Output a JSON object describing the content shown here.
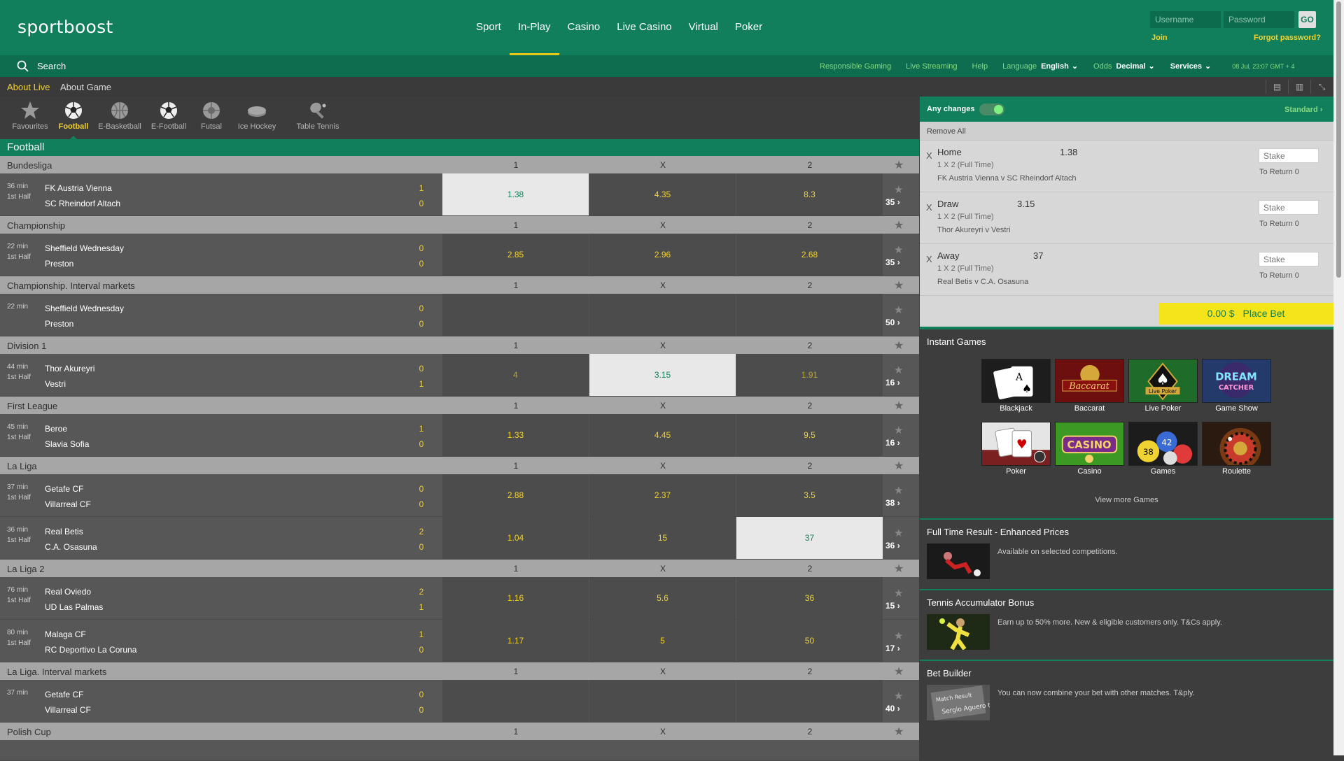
{
  "brand": {
    "logo": "sportboost"
  },
  "nav": [
    "Sport",
    "In-Play",
    "Casino",
    "Live Casino",
    "Virtual",
    "Poker"
  ],
  "login": {
    "username_placeholder": "Username",
    "password_placeholder": "Password",
    "go": "GO",
    "join": "Join",
    "forgot": "Forgot password?"
  },
  "subbar": {
    "search": "Search",
    "responsible": "Responsible Gaming",
    "streaming": "Live Streaming",
    "help": "Help",
    "language_label": "Language",
    "language_value": "English",
    "odds_label": "Odds",
    "odds_value": "Decimal",
    "services": "Services",
    "clock": "08 Jul, 23:07 GMT + 4"
  },
  "context": {
    "about_live": "About Live",
    "about_game": "About Game"
  },
  "sports": [
    {
      "label": "Favourites",
      "icon": "star-icon",
      "active": false
    },
    {
      "label": "Football",
      "icon": "football-icon",
      "active": true
    },
    {
      "label": "E-Basketball",
      "icon": "basketball-icon",
      "active": false
    },
    {
      "label": "E-Football",
      "icon": "football-icon",
      "active": false
    },
    {
      "label": "Futsal",
      "icon": "futsal-icon",
      "active": false
    },
    {
      "label": "Ice Hockey",
      "icon": "puck-icon",
      "active": false
    },
    {
      "label": "Table Tennis",
      "icon": "paddle-icon",
      "active": false
    }
  ],
  "section_title": "Football",
  "cols": {
    "one": "1",
    "x": "X",
    "two": "2"
  },
  "leagues": [
    {
      "name": "Bundesliga",
      "events": [
        {
          "time": "36 min",
          "period": "1st Half",
          "home": "FK Austria Vienna",
          "away": "SC Rheindorf Altach",
          "hs": "1",
          "as": "0",
          "o1": "1.38",
          "ox": "4.35",
          "o2": "8.3",
          "more": "35",
          "selected": "1"
        }
      ]
    },
    {
      "name": "Championship",
      "events": [
        {
          "time": "22 min",
          "period": "1st Half",
          "home": "Sheffield Wednesday",
          "away": "Preston",
          "hs": "0",
          "as": "0",
          "o1": "2.85",
          "ox": "2.96",
          "o2": "2.68",
          "more": "35",
          "selected": ""
        }
      ]
    },
    {
      "name": "Championship. Interval markets",
      "events": [
        {
          "time": "22 min",
          "period": "",
          "home": "Sheffield Wednesday",
          "away": "Preston",
          "hs": "0",
          "as": "0",
          "o1": "",
          "ox": "",
          "o2": "",
          "more": "50",
          "selected": "",
          "suspended": true
        }
      ]
    },
    {
      "name": "Division 1",
      "events": [
        {
          "time": "44 min",
          "period": "1st Half",
          "home": "Thor Akureyri",
          "away": "Vestri",
          "hs": "0",
          "as": "1",
          "o1": "4",
          "ox": "3.15",
          "o2": "1.91",
          "more": "16",
          "selected": "x",
          "dim": true
        }
      ]
    },
    {
      "name": "First League",
      "events": [
        {
          "time": "45 min",
          "period": "1st Half",
          "home": "Beroe",
          "away": "Slavia Sofia",
          "hs": "1",
          "as": "0",
          "o1": "1.33",
          "ox": "4.45",
          "o2": "9.5",
          "more": "16",
          "selected": ""
        }
      ]
    },
    {
      "name": "La Liga",
      "events": [
        {
          "time": "37 min",
          "period": "1st Half",
          "home": "Getafe CF",
          "away": "Villarreal CF",
          "hs": "0",
          "as": "0",
          "o1": "2.88",
          "ox": "2.37",
          "o2": "3.5",
          "more": "38",
          "selected": ""
        },
        {
          "time": "36 min",
          "period": "1st Half",
          "home": "Real Betis",
          "away": "C.A. Osasuna",
          "hs": "2",
          "as": "0",
          "o1": "1.04",
          "ox": "15",
          "o2": "37",
          "more": "36",
          "selected": "2"
        }
      ]
    },
    {
      "name": "La Liga 2",
      "events": [
        {
          "time": "76 min",
          "period": "1st Half",
          "home": "Real Oviedo",
          "away": "UD Las Palmas",
          "hs": "2",
          "as": "1",
          "o1": "1.16",
          "ox": "5.6",
          "o2": "36",
          "more": "15",
          "selected": ""
        },
        {
          "time": "80 min",
          "period": "1st Half",
          "home": "Malaga CF",
          "away": "RC Deportivo La Coruna",
          "hs": "1",
          "as": "0",
          "o1": "1.17",
          "ox": "5",
          "o2": "50",
          "more": "17",
          "selected": ""
        }
      ]
    },
    {
      "name": "La Liga. Interval markets",
      "events": [
        {
          "time": "37 min",
          "period": "",
          "home": "Getafe CF",
          "away": "Villarreal CF",
          "hs": "0",
          "as": "0",
          "o1": "",
          "ox": "",
          "o2": "",
          "more": "40",
          "selected": "",
          "suspended": true
        }
      ]
    },
    {
      "name": "Polish Cup",
      "events": []
    }
  ],
  "betslip": {
    "any_changes": "Any changes",
    "standard": "Standard",
    "remove_all": "Remove All",
    "items": [
      {
        "selection": "Home",
        "price": "1.38",
        "market": "1 X 2 (Full Time)",
        "event": "FK Austria Vienna v SC Rheindorf Altach",
        "stake_placeholder": "Stake",
        "to_return": "To Return 0"
      },
      {
        "selection": "Draw",
        "price": "3.15",
        "market": "1 X 2 (Full Time)",
        "event": "Thor Akureyri v Vestri",
        "stake_placeholder": "Stake",
        "to_return": "To Return 0"
      },
      {
        "selection": "Away",
        "price": "37",
        "market": "1 X 2 (Full Time)",
        "event": "Real Betis v C.A. Osasuna",
        "stake_placeholder": "Stake",
        "to_return": "To Return 0"
      }
    ],
    "total": "0.00 $",
    "place_bet": "Place Bet"
  },
  "instant_games": {
    "title": "Instant Games",
    "games": [
      "Blackjack",
      "Baccarat",
      "Live Poker",
      "Game Show",
      "Poker",
      "Casino",
      "Games",
      "Roulette"
    ],
    "view_more": "View more Games"
  },
  "promos": [
    {
      "title": "Full Time Result - Enhanced Prices",
      "text": "Available on selected competitions."
    },
    {
      "title": "Tennis Accumulator Bonus",
      "text": "Earn up to 50% more. New & eligible customers only. T&Cs apply."
    },
    {
      "title": "Bet Builder",
      "text": "You can now combine your bet with other matches. T&ply."
    }
  ],
  "colors": {
    "brand_green": "#127f5c",
    "accent_yellow": "#f0d230",
    "place_bet": "#f5e41a"
  }
}
